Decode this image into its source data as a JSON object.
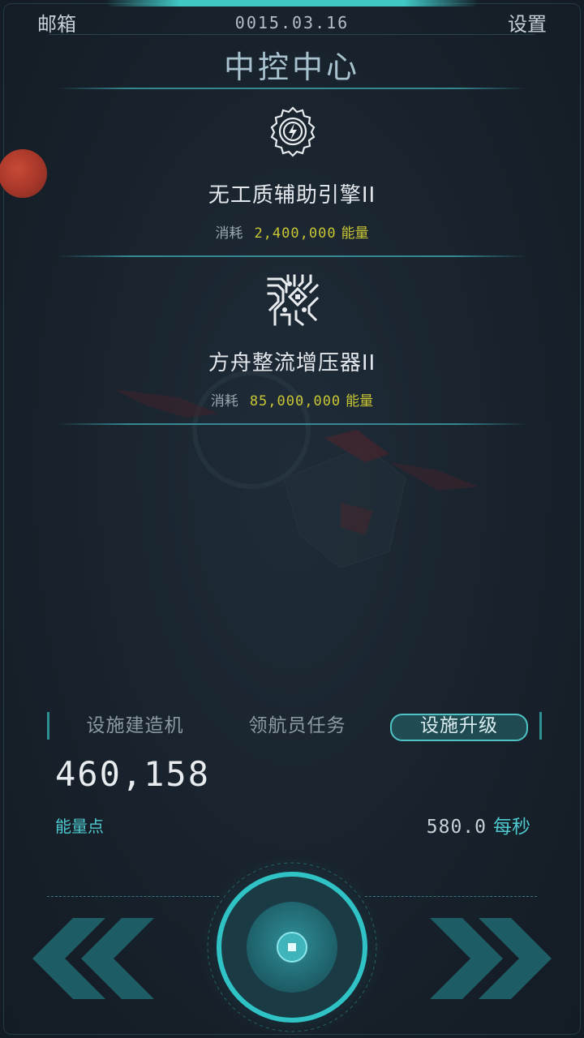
{
  "header": {
    "mail_label": "邮箱",
    "date": "0015.03.16",
    "settings_label": "设置",
    "title": "中控中心"
  },
  "upgrades": [
    {
      "icon": "engine-gear-icon",
      "name": "无工质辅助引擎II",
      "cost_label": "消耗",
      "cost_value": "2,400,000",
      "cost_unit": "能量"
    },
    {
      "icon": "circuit-chip-icon",
      "name": "方舟整流增压器II",
      "cost_label": "消耗",
      "cost_value": "85,000,000",
      "cost_unit": "能量"
    }
  ],
  "tabs": [
    {
      "label": "设施建造机",
      "active": false
    },
    {
      "label": "领航员任务",
      "active": false
    },
    {
      "label": "设施升级",
      "active": true
    }
  ],
  "energy": {
    "value": "460,158",
    "label": "能量点",
    "rate_value": "580.0",
    "rate_unit": "每秒"
  },
  "colors": {
    "accent": "#4fc9d0",
    "cost": "#c9c633",
    "background": "#1b2530"
  }
}
